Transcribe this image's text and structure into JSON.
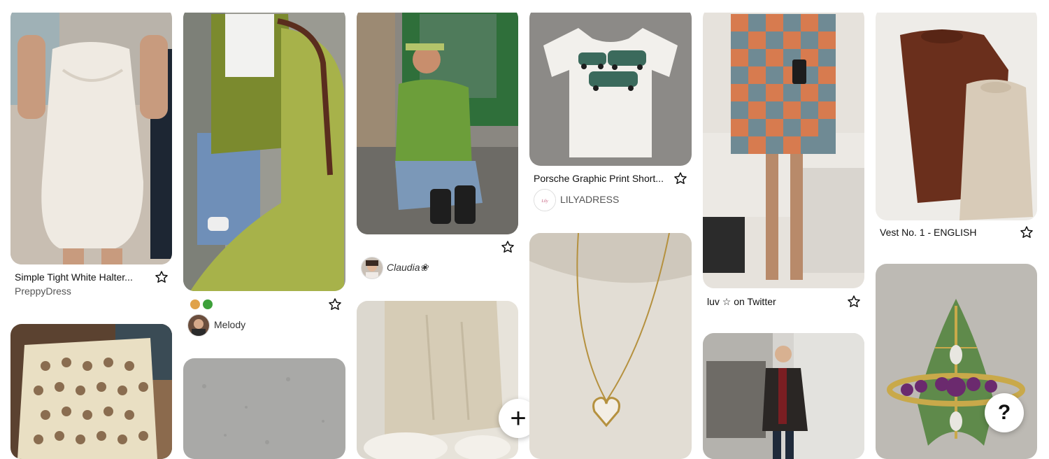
{
  "pins": {
    "col1_top": {
      "title": "Simple Tight White Halter...",
      "source": "PreppyDress"
    },
    "col2_top": {
      "emoji_row": "",
      "author": "Melody"
    },
    "col3_top": {
      "author": "Claudia❀"
    },
    "col4_top": {
      "title": "Porsche Graphic Print Short...",
      "source": "LILYADRESS"
    },
    "col5_top": {
      "title": "luv ☆ on Twitter"
    },
    "col6_top": {
      "title": "Vest No. 1 - ENGLISH"
    }
  },
  "buttons": {
    "add_label": "+",
    "help_label": "?"
  },
  "icons": {
    "save": "star-icon",
    "add": "plus-icon",
    "help": "question-icon"
  },
  "colors": {
    "background": "#ffffff",
    "text": "#111111",
    "subtext": "#555555"
  }
}
